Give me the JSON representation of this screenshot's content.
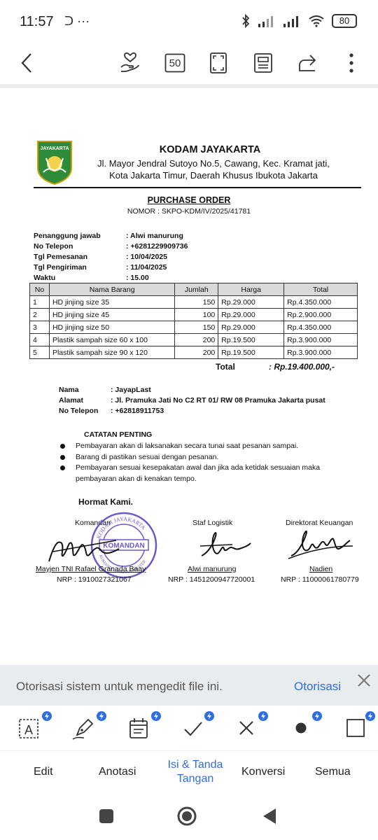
{
  "status_bar": {
    "time": "11:57",
    "extra_icons": "ᑐ ···",
    "battery": "80"
  },
  "toolbar": {
    "page_count_label": "50",
    "icons": [
      "back-icon",
      "hand-heart-icon",
      "page-count-icon",
      "fullscreen-icon",
      "reading-mode-icon",
      "share-icon",
      "more-icon"
    ]
  },
  "document": {
    "org": {
      "name": "KODAM JAYAKARTA",
      "address_line1": "Jl. Mayor Jendral Sutoyo No.5, Cawang, Kec. Kramat jati,",
      "address_line2": "Kota Jakarta Timur, Daerah Khusus Ibukota Jakarta",
      "logo_text": "JAYAKARTA"
    },
    "title": "PURCHASE ORDER",
    "number": "NOMOR : SKPO-KDM/IV/2025/41781",
    "info": [
      {
        "label": "Penanggung jawab",
        "value": ": Alwi manurung"
      },
      {
        "label": "No Telepon",
        "value": ": +6281229909736"
      },
      {
        "label": "Tgl Pemesanan",
        "value": ": 10/04/2025"
      },
      {
        "label": "Tgl Pengiriman",
        "value": ": 11/04/2025"
      },
      {
        "label": "Waktu",
        "value": ": 15.00"
      }
    ],
    "table": {
      "headers": [
        "No",
        "Nama Barang",
        "Jumlah",
        "Harga",
        "Total"
      ],
      "rows": [
        [
          "1",
          "HD jinjing size 35",
          "150",
          "Rp.29.000",
          "Rp.4.350.000"
        ],
        [
          "2",
          "HD jinjing size 45",
          "100",
          "Rp.29.000",
          "Rp.2.900.000"
        ],
        [
          "3",
          "HD jinjing size 50",
          "150",
          "Rp.29.000",
          "Rp.4.350.000"
        ],
        [
          "4",
          "Plastik sampah size 60 x 100",
          "200",
          "Rp.19.500",
          "Rp.3.900.000"
        ],
        [
          "5",
          "Plastik sampah size 90 x 120",
          "200",
          "Rp.19.500",
          "Rp.3.900.000"
        ]
      ]
    },
    "total_label": "Total",
    "total_value": ": Rp.19.400.000,-",
    "supplier": [
      {
        "label": "Nama",
        "value": ": JayapLast"
      },
      {
        "label": "Alamat",
        "value": ": Jl. Pramuka Jati No C2 RT 01/ RW 08 Pramuka Jakarta pusat"
      },
      {
        "label": "No Telepon",
        "value": ": +62818911753"
      }
    ],
    "notes_title": "CATATAN PENTING",
    "notes": [
      "Pembayaran akan di laksanakan secara tunai saat pesanan sampai.",
      "Barang di pastikan sesuai dengan pesanan.",
      "Pembayaran sesuai kesepakatan awal dan jika ada ketidak sesuaian maka pembayaran akan di kenakan tempo."
    ],
    "closing": "Hormat Kami.",
    "signatories": [
      {
        "role": "Komandan",
        "name": "Mayjen TNI  Rafael Granada Baay",
        "nrp": "NRP : 1910027321067"
      },
      {
        "role": "Staf Logistik",
        "name": "Alwi manurung",
        "nrp": "NRP : 1451200947720001"
      },
      {
        "role": "Direktorat Keuangan",
        "name": "Nadien",
        "nrp": "NRP : 11000061780779"
      }
    ],
    "stamp": {
      "center": "KOMANDAN",
      "ring_top": "KODAM JAYAKARTA",
      "ring_bottom": "KOMANDO DAERAH MILITER"
    }
  },
  "auth_banner": {
    "message": "Otorisasi sistem untuk mengedit file ini.",
    "action": "Otorisasi"
  },
  "tools": [
    "text-box-icon",
    "pen-sign-icon",
    "calendar-icon",
    "check-icon",
    "cross-icon",
    "dot-icon",
    "square-icon"
  ],
  "tabs": [
    {
      "label": "Edit",
      "active": false
    },
    {
      "label": "Anotasi",
      "active": false
    },
    {
      "label": "Isi & Tanda Tangan",
      "active": true
    },
    {
      "label": "Konversi",
      "active": false
    },
    {
      "label": "Semua",
      "active": false
    }
  ],
  "colors": {
    "accent": "#2f6de1",
    "banner_bg": "#e9ecef",
    "stamp": "#6b58c9"
  }
}
